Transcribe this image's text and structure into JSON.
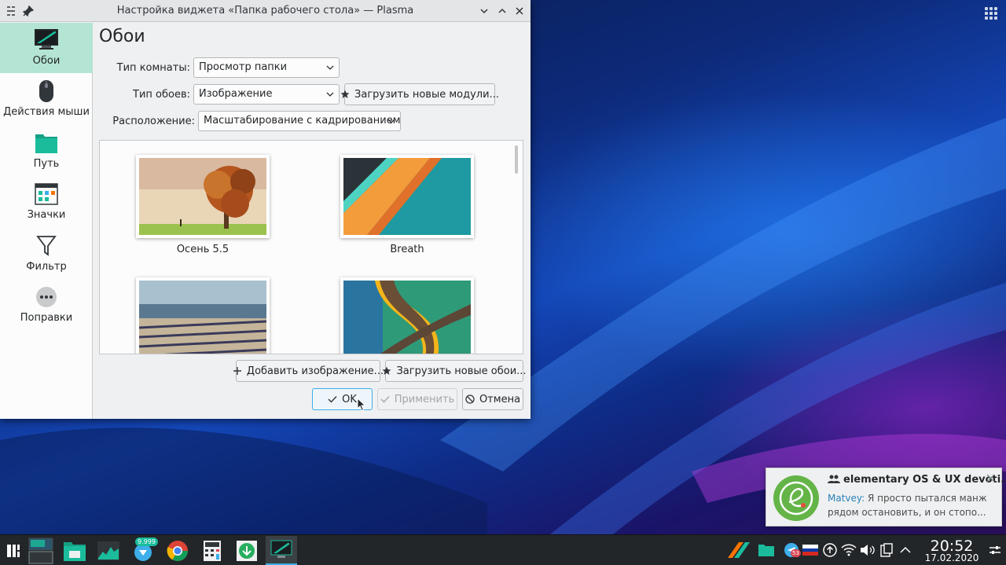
{
  "window": {
    "title": "Настройка виджета «Папка рабочего стола» — Plasma"
  },
  "sidebar": {
    "items": [
      {
        "label": "Обои",
        "icon": "monitor-wallpaper-icon",
        "active": true
      },
      {
        "label": "Действия мыши",
        "icon": "mouse-icon",
        "active": false
      },
      {
        "label": "Путь",
        "icon": "folder-icon",
        "active": false
      },
      {
        "label": "Значки",
        "icon": "icons-grid-icon",
        "active": false
      },
      {
        "label": "Фильтр",
        "icon": "filter-icon",
        "active": false
      },
      {
        "label": "Поправки",
        "icon": "more-icon",
        "active": false
      }
    ]
  },
  "page": {
    "title": "Обои",
    "layout_label": "Тип комнаты:",
    "layout_value": "Просмотр папки",
    "wallpaper_type_label": "Тип обоев:",
    "wallpaper_type_value": "Изображение",
    "get_plugins_label": "Загрузить новые модули...",
    "positioning_label": "Расположение:",
    "positioning_value": "Масштабирование с кадрированием"
  },
  "wallpapers": [
    {
      "name": "Осень 5.5"
    },
    {
      "name": "Breath"
    },
    {
      "name": ""
    },
    {
      "name": ""
    }
  ],
  "actions": {
    "add_image": "Добавить изображение...",
    "get_new_wallpapers": "Загрузить новые обои...",
    "ok": "OK",
    "apply": "Применить",
    "cancel": "Отмена"
  },
  "notification": {
    "title": "elementary OS & UX devoti...",
    "sender": "Matvey:",
    "message_line1": " Я просто пытался манж",
    "message_line2": "рядом остановить, и он стопо..."
  },
  "taskbar": {
    "updates_badge": "9.999",
    "telegram_badge": "53",
    "clock_time": "20:52",
    "clock_date": "17.02.2020"
  },
  "colors": {
    "accent": "#3daee9",
    "sidebar_active": "#b4e4d3",
    "taskbar": "#232629"
  }
}
